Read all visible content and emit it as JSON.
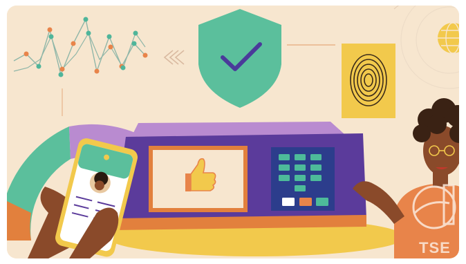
{
  "illustration": {
    "watermark_text": "TSE",
    "colors": {
      "background": "#f7e6cf",
      "shield": "#5bbf9c",
      "machine_body": "#5b3b9b",
      "machine_top": "#b98bd0",
      "machine_base": "#e2803d",
      "fingerprint_card": "#f2c94c",
      "keypad": "#2c3d8c",
      "keypad_keys": "#4dbb9a",
      "accent_orange": "#e8844a",
      "teal_dots": "#4fb59a"
    }
  }
}
